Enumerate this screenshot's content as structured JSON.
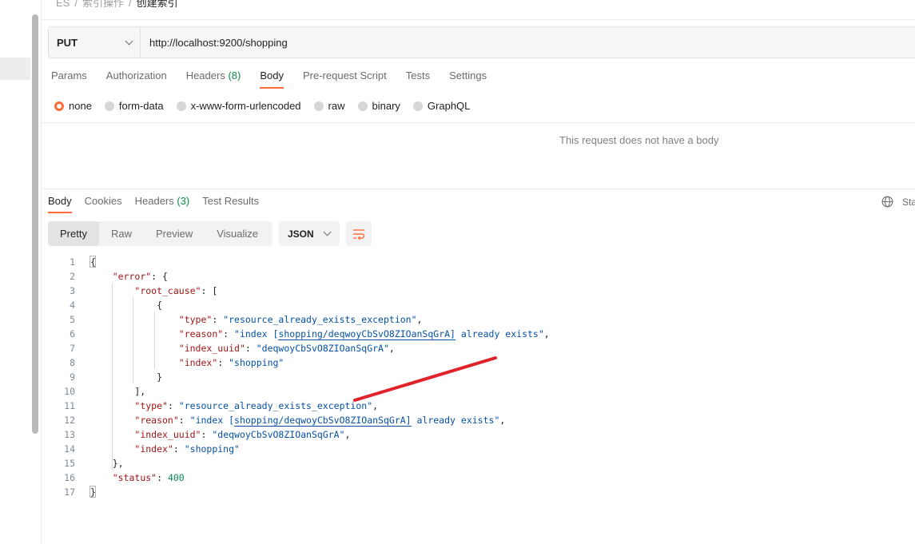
{
  "breadcrumb": [
    "ES",
    "索引操作",
    "创建索引"
  ],
  "request": {
    "method": "PUT",
    "url": "http://localhost:9200/shopping"
  },
  "request_tabs": [
    {
      "label": "Params",
      "count": ""
    },
    {
      "label": "Authorization",
      "count": ""
    },
    {
      "label": "Headers",
      "count": "(8)"
    },
    {
      "label": "Body",
      "count": "",
      "active": true
    },
    {
      "label": "Pre-request Script",
      "count": ""
    },
    {
      "label": "Tests",
      "count": ""
    },
    {
      "label": "Settings",
      "count": ""
    }
  ],
  "body_types": [
    {
      "label": "none",
      "selected": true
    },
    {
      "label": "form-data",
      "selected": false
    },
    {
      "label": "x-www-form-urlencoded",
      "selected": false
    },
    {
      "label": "raw",
      "selected": false
    },
    {
      "label": "binary",
      "selected": false
    },
    {
      "label": "GraphQL",
      "selected": false
    }
  ],
  "no_body_message": "This request does not have a body",
  "response_tabs": [
    {
      "label": "Body",
      "count": "",
      "active": true
    },
    {
      "label": "Cookies",
      "count": ""
    },
    {
      "label": "Headers",
      "count": "(3)"
    },
    {
      "label": "Test Results",
      "count": ""
    }
  ],
  "status_cut": "Sta",
  "view_modes": [
    "Pretty",
    "Raw",
    "Preview",
    "Visualize"
  ],
  "active_view": "Pretty",
  "format": "JSON",
  "code_lines": [
    {
      "n": "1",
      "tokens": [
        [
          "p",
          "{"
        ]
      ]
    },
    {
      "n": "2",
      "tokens": [
        [
          "p",
          "    "
        ],
        [
          "k",
          "\"error\""
        ],
        [
          "p",
          ": {"
        ]
      ]
    },
    {
      "n": "3",
      "tokens": [
        [
          "p",
          "        "
        ],
        [
          "k",
          "\"root_cause\""
        ],
        [
          "p",
          ": ["
        ]
      ]
    },
    {
      "n": "4",
      "tokens": [
        [
          "p",
          "            {"
        ]
      ]
    },
    {
      "n": "5",
      "tokens": [
        [
          "p",
          "                "
        ],
        [
          "k",
          "\"type\""
        ],
        [
          "p",
          ": "
        ],
        [
          "s",
          "\"resource_already_exists_exception\""
        ],
        [
          "p",
          ","
        ]
      ]
    },
    {
      "n": "6",
      "tokens": [
        [
          "p",
          "                "
        ],
        [
          "k",
          "\"reason\""
        ],
        [
          "p",
          ": "
        ],
        [
          "s",
          "\"index ["
        ],
        [
          "su",
          "shopping/deqwoyCbSvO8ZIOanSqGrA]"
        ],
        [
          "s",
          " already exists\""
        ],
        [
          "p",
          ","
        ]
      ]
    },
    {
      "n": "7",
      "tokens": [
        [
          "p",
          "                "
        ],
        [
          "k",
          "\"index_uuid\""
        ],
        [
          "p",
          ": "
        ],
        [
          "s",
          "\"deqwoyCbSvO8ZIOanSqGrA\""
        ],
        [
          "p",
          ","
        ]
      ]
    },
    {
      "n": "8",
      "tokens": [
        [
          "p",
          "                "
        ],
        [
          "k",
          "\"index\""
        ],
        [
          "p",
          ": "
        ],
        [
          "s",
          "\"shopping\""
        ]
      ]
    },
    {
      "n": "9",
      "tokens": [
        [
          "p",
          "            }"
        ]
      ]
    },
    {
      "n": "10",
      "tokens": [
        [
          "p",
          "        ],"
        ]
      ]
    },
    {
      "n": "11",
      "tokens": [
        [
          "p",
          "        "
        ],
        [
          "k",
          "\"type\""
        ],
        [
          "p",
          ": "
        ],
        [
          "s",
          "\"resource_already_exists_exception\""
        ],
        [
          "p",
          ","
        ]
      ]
    },
    {
      "n": "12",
      "tokens": [
        [
          "p",
          "        "
        ],
        [
          "k",
          "\"reason\""
        ],
        [
          "p",
          ": "
        ],
        [
          "s",
          "\"index ["
        ],
        [
          "su",
          "shopping/deqwoyCbSvO8ZIOanSqGrA]"
        ],
        [
          "s",
          " already exists\""
        ],
        [
          "p",
          ","
        ]
      ]
    },
    {
      "n": "13",
      "tokens": [
        [
          "p",
          "        "
        ],
        [
          "k",
          "\"index_uuid\""
        ],
        [
          "p",
          ": "
        ],
        [
          "s",
          "\"deqwoyCbSvO8ZIOanSqGrA\""
        ],
        [
          "p",
          ","
        ]
      ]
    },
    {
      "n": "14",
      "tokens": [
        [
          "p",
          "        "
        ],
        [
          "k",
          "\"index\""
        ],
        [
          "p",
          ": "
        ],
        [
          "s",
          "\"shopping\""
        ]
      ]
    },
    {
      "n": "15",
      "tokens": [
        [
          "p",
          "    },"
        ]
      ]
    },
    {
      "n": "16",
      "tokens": [
        [
          "p",
          "    "
        ],
        [
          "k",
          "\"status\""
        ],
        [
          "p",
          ": "
        ],
        [
          "n",
          "400"
        ]
      ]
    },
    {
      "n": "17",
      "tokens": [
        [
          "p",
          "}"
        ]
      ]
    }
  ],
  "colors": {
    "accent": "#ff6c37",
    "count_green": "#0b8a44",
    "json_key": "#a31515",
    "json_string": "#0451a5",
    "json_number": "#098658",
    "annotation_red": "#e0222a"
  }
}
